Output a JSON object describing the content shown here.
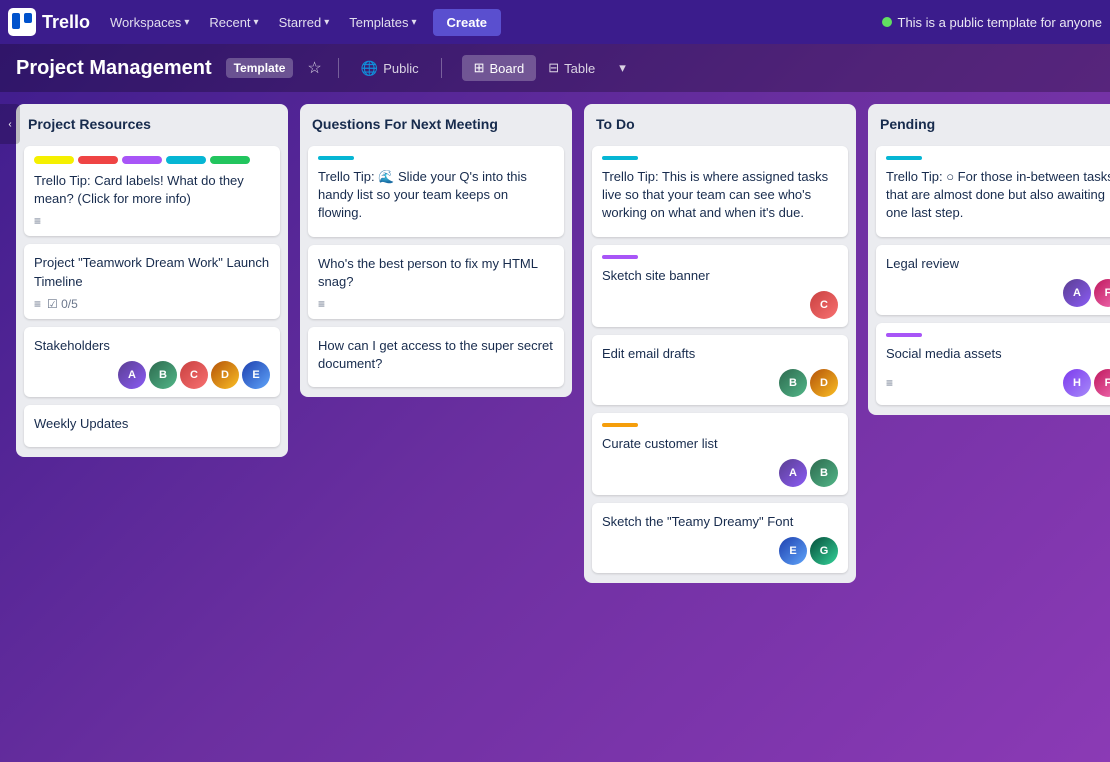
{
  "nav": {
    "logo": "Trello",
    "workspaces": "Workspaces",
    "recent": "Recent",
    "starred": "Starred",
    "templates": "Templates",
    "create": "Create",
    "public_template_text": "This is a public template for anyone"
  },
  "subheader": {
    "title": "Project Management",
    "template_badge": "Template",
    "public_label": "Public",
    "board_label": "Board",
    "table_label": "Table"
  },
  "lists": [
    {
      "id": "project-resources",
      "title": "Project Resources",
      "cards": [
        {
          "id": "card-labels",
          "labels": [
            "#f5f000",
            "#ef4444",
            "#a855f7",
            "#06b6d4",
            "#22c55e"
          ],
          "text": "Trello Tip: Card labels! What do they mean? (Click for more info)",
          "meta_icon": "≡",
          "footer": false
        },
        {
          "id": "card-timeline",
          "text": "Project \"Teamwork Dream Work\" Launch Timeline",
          "meta_icon": "≡",
          "checklist": "0/5",
          "footer": true
        },
        {
          "id": "card-stakeholders",
          "text": "Stakeholders",
          "avatars": [
            "av1",
            "av2",
            "av3",
            "av4",
            "av5"
          ],
          "footer": true
        },
        {
          "id": "card-weekly",
          "text": "Weekly Updates",
          "footer": false
        }
      ]
    },
    {
      "id": "questions-next-meeting",
      "title": "Questions For Next Meeting",
      "cards": [
        {
          "id": "card-tip-q",
          "bar_color": "#06b6d4",
          "text": "Trello Tip: 🌊 Slide your Q's into this handy list so your team keeps on flowing.",
          "footer": false
        },
        {
          "id": "card-html",
          "text": "Who's the best person to fix my HTML snag?",
          "meta_icon": "≡",
          "footer": true
        },
        {
          "id": "card-secret",
          "text": "How can I get access to the super secret document?",
          "footer": false
        }
      ]
    },
    {
      "id": "to-do",
      "title": "To Do",
      "cards": [
        {
          "id": "card-tip-todo",
          "bar_color": "#06b6d4",
          "text": "Trello Tip: This is where assigned tasks live so that your team can see who's working on what and when it's due.",
          "footer": false
        },
        {
          "id": "card-sketch-banner",
          "bar_color": "#a855f7",
          "text": "Sketch site banner",
          "avatars": [
            "av3"
          ],
          "footer": true
        },
        {
          "id": "card-email",
          "text": "Edit email drafts",
          "avatars": [
            "av2",
            "av4"
          ],
          "footer": true
        },
        {
          "id": "card-curate",
          "bar_color": "#f59e0b",
          "text": "Curate customer list",
          "avatars": [
            "av1",
            "av2"
          ],
          "footer": true
        },
        {
          "id": "card-font",
          "text": "Sketch the \"Teamy Dreamy\" Font",
          "avatars": [
            "av5",
            "av7"
          ],
          "footer": true
        }
      ]
    },
    {
      "id": "pending",
      "title": "Pending",
      "cards": [
        {
          "id": "card-tip-pending",
          "bar_color": "#06b6d4",
          "text": "Trello Tip: ○ For those in-between tasks that are almost done but also awaiting one last step.",
          "footer": false
        },
        {
          "id": "card-legal",
          "bar_color": null,
          "text": "Legal review",
          "avatars": [
            "av1",
            "av6"
          ],
          "footer": true
        },
        {
          "id": "card-social",
          "bar_color": "#a855f7",
          "text": "Social media assets",
          "meta_icon": "≡",
          "avatars": [
            "av8",
            "av6"
          ],
          "footer": true
        }
      ]
    }
  ]
}
